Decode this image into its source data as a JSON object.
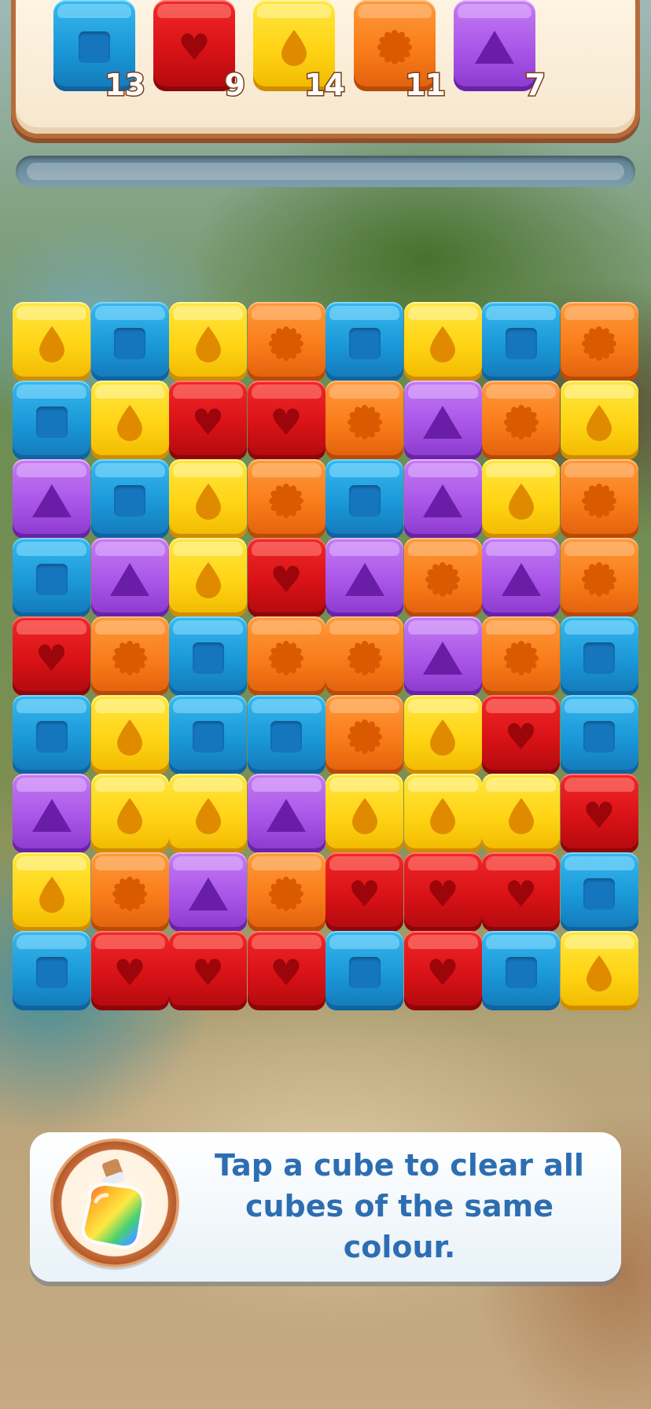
{
  "goals": [
    {
      "color": "blue",
      "symbol": "square",
      "count": "13"
    },
    {
      "color": "red",
      "symbol": "heart",
      "count": "9"
    },
    {
      "color": "yellow",
      "symbol": "drop",
      "count": "14"
    },
    {
      "color": "orange",
      "symbol": "flower",
      "count": "11"
    },
    {
      "color": "purple",
      "symbol": "triangle",
      "count": "7"
    }
  ],
  "progress": 0,
  "board": {
    "rows": [
      [
        "Y",
        "B",
        "Y",
        "O",
        "B",
        "Y",
        "B",
        "O"
      ],
      [
        "B",
        "Y",
        "R",
        "R",
        "O",
        "P",
        "O",
        "Y"
      ],
      [
        "P",
        "B",
        "Y",
        "O",
        "B",
        "P",
        "Y",
        "O"
      ],
      [
        "B",
        "P",
        "Y",
        "R",
        "P",
        "O",
        "P",
        "O"
      ],
      [
        "R",
        "O",
        "B",
        "O",
        "O",
        "P",
        "O",
        "B"
      ],
      [
        "B",
        "Y",
        "B",
        "B",
        "O",
        "Y",
        "R",
        "B"
      ],
      [
        "P",
        "Y",
        "Y",
        "P",
        "Y",
        "Y",
        "Y",
        "R"
      ],
      [
        "Y",
        "O",
        "P",
        "O",
        "R",
        "R",
        "R",
        "B"
      ],
      [
        "B",
        "R",
        "R",
        "R",
        "B",
        "R",
        "B",
        "Y"
      ]
    ],
    "legend": {
      "B": {
        "color": "blue",
        "symbol": "square"
      },
      "R": {
        "color": "red",
        "symbol": "heart"
      },
      "Y": {
        "color": "yellow",
        "symbol": "drop"
      },
      "O": {
        "color": "orange",
        "symbol": "flower"
      },
      "P": {
        "color": "purple",
        "symbol": "triangle"
      }
    }
  },
  "hint": {
    "icon": "rainbow-potion-icon",
    "text": "Tap a cube to clear all cubes of the same colour."
  }
}
